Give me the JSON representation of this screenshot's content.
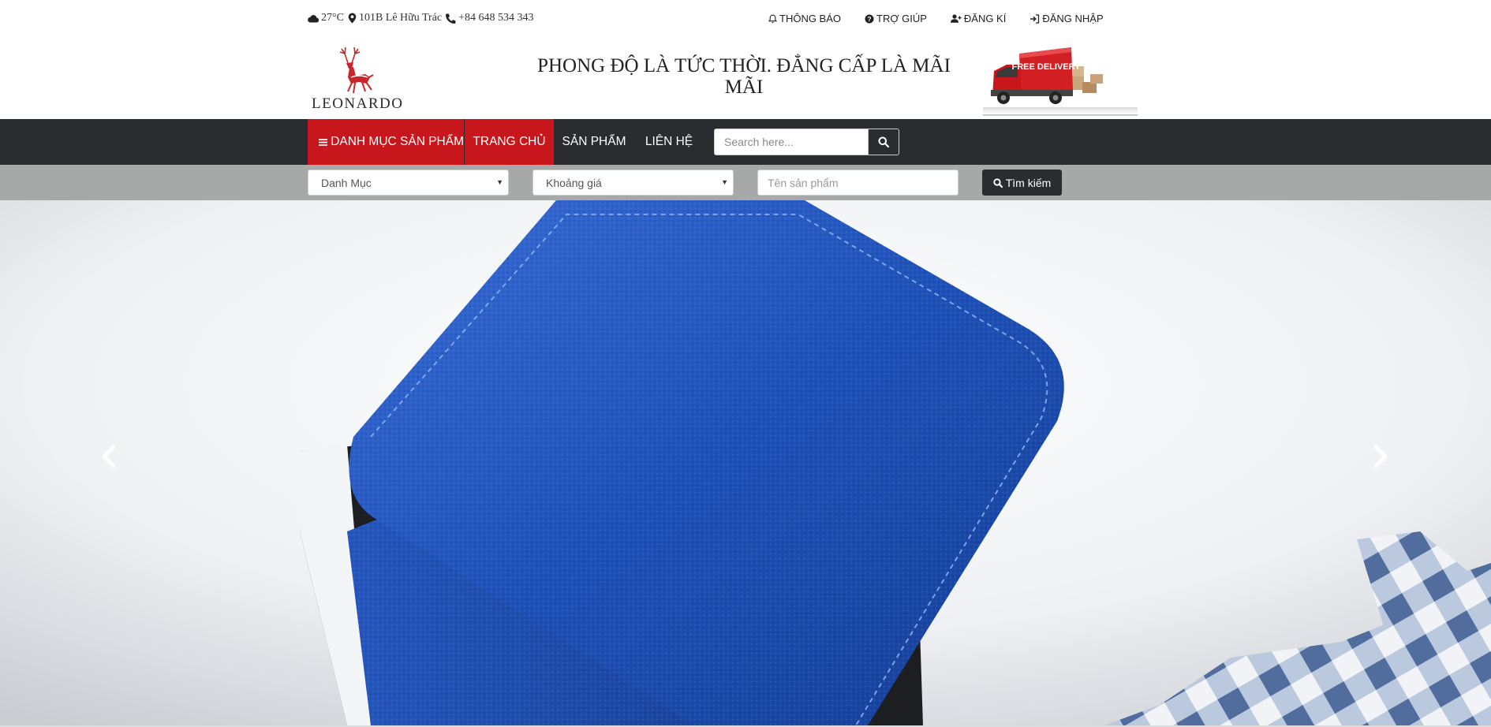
{
  "topbar": {
    "weather": "27°C",
    "address": "101B Lê Hữu Trác",
    "phone": "+84 648 534 343",
    "links": {
      "notifications": "THÔNG BÁO",
      "help": "TRỢ GIÚP",
      "register": "ĐĂNG KÍ",
      "login": "ĐĂNG NHẬP"
    }
  },
  "header": {
    "brand": "LEONARDO",
    "slogan": "PHONG ĐỘ LÀ TỨC THỜI. ĐẲNG CẤP LÀ MÃI MÃI",
    "banner_text": "FREE DELIVERY"
  },
  "nav": {
    "category": "DANH MỤC SẢN PHẨM",
    "home": "TRANG CHỦ",
    "products": "SẢN PHẨM",
    "contact": "LIÊN HỆ",
    "search_placeholder": "Search here..."
  },
  "filter": {
    "category_value": "Danh Mục",
    "price_value": "Khoảng giá",
    "name_placeholder": "Tên sản phẩm",
    "search_label": "Tìm kiếm"
  },
  "colors": {
    "accent_red": "#c8171c",
    "nav_dark": "#2b2c30",
    "filter_gray": "#a7a8a8",
    "wallet_blue": "#1e4fb4"
  },
  "icons": {
    "weather": "cloud-icon",
    "address": "map-marker-icon",
    "phone": "phone-icon",
    "notifications": "bell-icon",
    "help": "question-circle-icon",
    "register": "user-plus-icon",
    "login": "sign-in-icon",
    "category": "bars-icon",
    "search": "search-icon",
    "carousel_prev": "chevron-left-icon",
    "carousel_next": "chevron-right-icon"
  }
}
